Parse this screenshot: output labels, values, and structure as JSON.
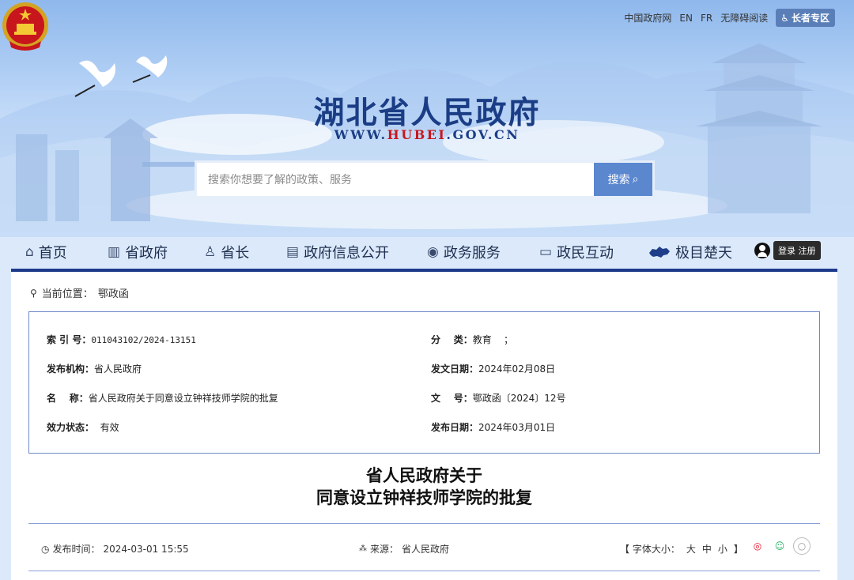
{
  "top_links": [
    "中国政府网",
    "EN",
    "FR",
    "无障碍阅读"
  ],
  "elder_label": "长者专区",
  "site_title": "湖北省人民政府",
  "site_url": {
    "prefix": "WWW.",
    "highlight": "HUBEI",
    "suffix": ".GOV.CN"
  },
  "search": {
    "placeholder": "搜索你想要了解的政策、服务",
    "button": "搜索"
  },
  "nav": [
    {
      "label": "首页",
      "icon": "home-icon",
      "glyph": "⌂"
    },
    {
      "label": "省政府",
      "icon": "building-icon",
      "glyph": "▥"
    },
    {
      "label": "省长",
      "icon": "person-icon",
      "glyph": "♙"
    },
    {
      "label": "政府信息公开",
      "icon": "document-icon",
      "glyph": "▤"
    },
    {
      "label": "政务服务",
      "icon": "service-icon",
      "glyph": "◉"
    },
    {
      "label": "政民互动",
      "icon": "chat-icon",
      "glyph": "▭"
    },
    {
      "label": "极目楚天",
      "icon": "hubei-map-icon",
      "glyph": ""
    }
  ],
  "login_label": "登录 注册",
  "breadcrumb": {
    "label": "当前位置：",
    "current": "鄂政函"
  },
  "meta": {
    "index_label": "索 引 号：",
    "index_value": "011043102/2024-13151",
    "category_label": "分    类：",
    "category_value": "教育    ；",
    "org_label": "发布机构：",
    "org_value": "省人民政府",
    "issue_date_label": "发文日期：",
    "issue_date_value": "2024年02月08日",
    "name_label": "名    称：",
    "name_value": "省人民政府关于同意设立钟祥技师学院的批复",
    "doc_no_label": "文    号：",
    "doc_no_value": "鄂政函〔2024〕12号",
    "status_label": "效力状态：",
    "status_value": "有效",
    "publish_date_label": "发布日期：",
    "publish_date_value": "2024年03月01日"
  },
  "article": {
    "title_line1": "省人民政府关于",
    "title_line2": "同意设立钟祥技师学院的批复"
  },
  "info": {
    "time_label": "发布时间：",
    "time_value": "2024-03-01 15:55",
    "source_label": "来源：",
    "source_value": "省人民政府",
    "font_label": "【 字体大小：",
    "font_large": "大",
    "font_mid": "中",
    "font_small": "小",
    "font_end": "】"
  }
}
